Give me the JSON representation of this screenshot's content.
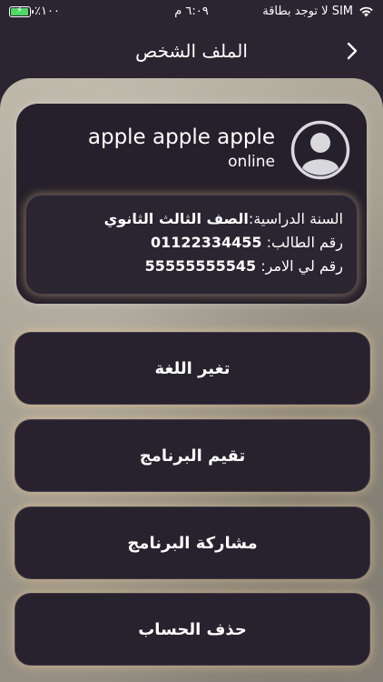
{
  "status_bar": {
    "battery": "٪١٠٠",
    "time": "٦:٠٩ م",
    "carrier": "لا توجد بطاقة SIM"
  },
  "nav": {
    "title": "الملف الشخص"
  },
  "profile": {
    "name": "apple apple apple",
    "status": "online",
    "year_label": "السنة الدراسية:",
    "year_value": "الصف الثالث الثانوي",
    "student_label": "رقم الطالب: ",
    "student_value": "01122334455",
    "parent_label": "رقم لي الامر: ",
    "parent_value": "55555555545"
  },
  "menu": {
    "change_language": "تغير اللغة",
    "rate_app": "تقيم البرنامج",
    "share_app": "مشاركة البرنامج",
    "delete_account": "حذف الحساب"
  }
}
